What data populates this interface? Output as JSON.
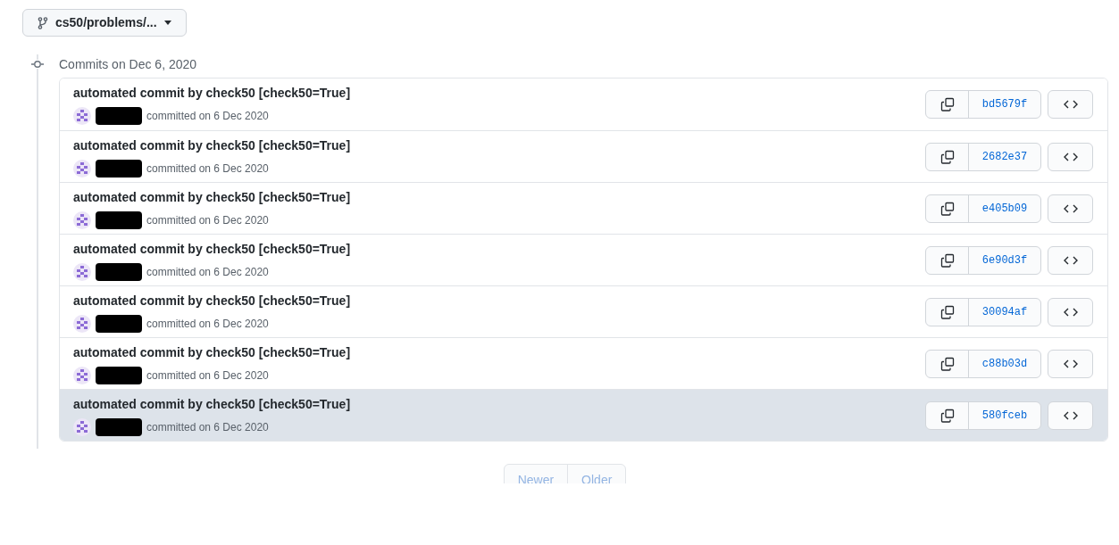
{
  "branch_selector": {
    "label": "cs50/problems/..."
  },
  "timeline": {
    "heading": "Commits on Dec 6, 2020"
  },
  "commits": [
    {
      "message": "automated commit by check50 [check50=True]",
      "meta": "committed on 6 Dec 2020",
      "sha": "bd5679f",
      "highlighted": false
    },
    {
      "message": "automated commit by check50 [check50=True]",
      "meta": "committed on 6 Dec 2020",
      "sha": "2682e37",
      "highlighted": false
    },
    {
      "message": "automated commit by check50 [check50=True]",
      "meta": "committed on 6 Dec 2020",
      "sha": "e405b09",
      "highlighted": false
    },
    {
      "message": "automated commit by check50 [check50=True]",
      "meta": "committed on 6 Dec 2020",
      "sha": "6e90d3f",
      "highlighted": false
    },
    {
      "message": "automated commit by check50 [check50=True]",
      "meta": "committed on 6 Dec 2020",
      "sha": "30094af",
      "highlighted": false
    },
    {
      "message": "automated commit by check50 [check50=True]",
      "meta": "committed on 6 Dec 2020",
      "sha": "c88b03d",
      "highlighted": false
    },
    {
      "message": "automated commit by check50 [check50=True]",
      "meta": "committed on 6 Dec 2020",
      "sha": "580fceb",
      "highlighted": true
    }
  ],
  "pagination": [
    {
      "label": "Newer",
      "disabled": true
    },
    {
      "label": "Older",
      "disabled": true
    }
  ]
}
